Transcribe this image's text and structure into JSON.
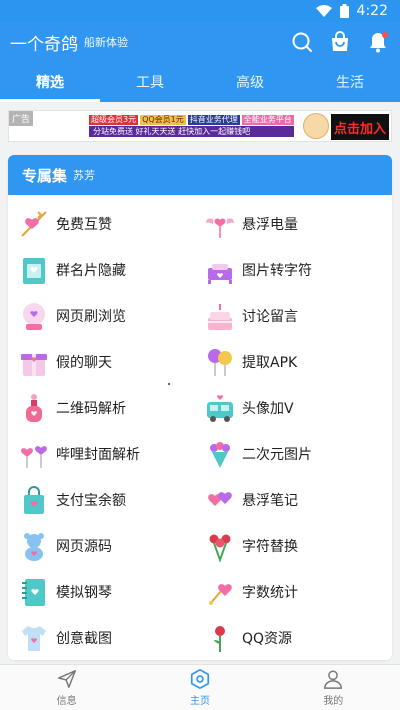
{
  "status": {
    "time": "4:22"
  },
  "app": {
    "title": "一个奇鸽",
    "subtitle": "船新体验"
  },
  "header_icons": [
    "search-icon",
    "bag-icon",
    "bell-icon"
  ],
  "tabs": [
    {
      "label": "精选",
      "active": true
    },
    {
      "label": "工具"
    },
    {
      "label": "高级"
    },
    {
      "label": "生活"
    }
  ],
  "ad": {
    "tag": "广告",
    "chips": [
      "超级会员3元",
      "QQ会员1元",
      "抖音业务代理",
      "全能业务平台"
    ],
    "banner": "分站免费送 好礼天天送 赶快加入一起赚钱吧",
    "cta": "点击加入"
  },
  "section": {
    "title": "专属集",
    "subtitle": "苏芳"
  },
  "items": [
    {
      "label": "免费互赞",
      "icon": "heart-arrow-icon"
    },
    {
      "label": "悬浮电量",
      "icon": "winged-heart-icon"
    },
    {
      "label": "群名片隐藏",
      "icon": "card-icon"
    },
    {
      "label": "图片转字符",
      "icon": "bed-icon"
    },
    {
      "label": "网页刷浏览",
      "icon": "snow-globe-icon"
    },
    {
      "label": "讨论留言",
      "icon": "cake-icon"
    },
    {
      "label": "假的聊天",
      "icon": "gift-box-icon"
    },
    {
      "label": "提取APK",
      "icon": "balloons-icon"
    },
    {
      "label": "二维码解析",
      "icon": "perfume-icon"
    },
    {
      "label": "头像加V",
      "icon": "van-icon"
    },
    {
      "label": "哔哩封面解析",
      "icon": "heart-balloons-icon"
    },
    {
      "label": "二次元图片",
      "icon": "bouquet-icon"
    },
    {
      "label": "支付宝余额",
      "icon": "shopping-bag-icon"
    },
    {
      "label": "悬浮笔记",
      "icon": "hearts-pair-icon"
    },
    {
      "label": "网页源码",
      "icon": "teddy-bear-icon"
    },
    {
      "label": "字符替换",
      "icon": "roses-icon"
    },
    {
      "label": "模拟钢琴",
      "icon": "notebook-icon"
    },
    {
      "label": "字数统计",
      "icon": "heart-wand-icon"
    },
    {
      "label": "创意截图",
      "icon": "tshirt-icon"
    },
    {
      "label": "QQ资源",
      "icon": "rose-glass-icon"
    }
  ],
  "bottom_nav": [
    {
      "label": "信息",
      "icon": "send-icon"
    },
    {
      "label": "主页",
      "icon": "home-hex-icon",
      "active": true
    },
    {
      "label": "我的",
      "icon": "user-icon"
    }
  ],
  "colors": {
    "primary": "#2f97f2",
    "pink": "#f36da6",
    "teal": "#4fc9c8",
    "purple": "#b86ae8"
  }
}
